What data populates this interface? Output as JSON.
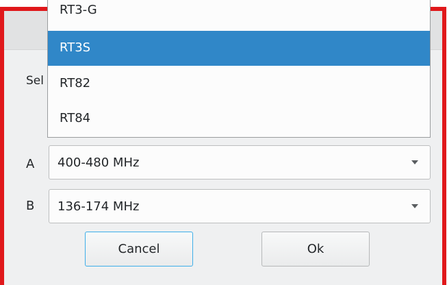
{
  "dialog": {
    "prompt_label": "Sel",
    "channel_a": {
      "label": "A",
      "value": "400-480 MHz"
    },
    "channel_b": {
      "label": "B",
      "value": "136-174 MHz"
    },
    "cancel_label": "Cancel",
    "ok_label": "Ok"
  },
  "model_dropdown": {
    "options": [
      "RT3-G",
      "RT3S",
      "RT82",
      "RT84"
    ],
    "selected": "RT3S"
  },
  "colors": {
    "window_border": "#e0181b",
    "selection": "#3087c8",
    "focus": "#3daee9"
  }
}
